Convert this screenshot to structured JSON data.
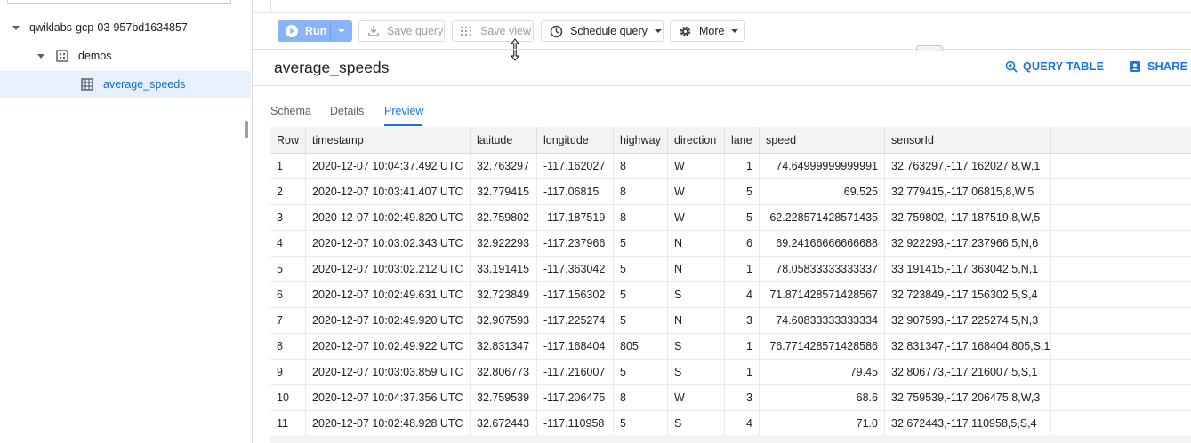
{
  "sidebar": {
    "project": "qwiklabs-gcp-03-957bd1634857",
    "dataset": "demos",
    "table": "average_speeds"
  },
  "toolbar": {
    "run": "Run",
    "save_query": "Save query",
    "save_view": "Save view",
    "schedule_query": "Schedule query",
    "more": "More"
  },
  "details": {
    "title": "average_speeds",
    "query_table": "QUERY TABLE",
    "share_table": "SHARE T"
  },
  "tabs": [
    "Schema",
    "Details",
    "Preview"
  ],
  "active_tab": "Preview",
  "colors": {
    "accent": "#1a73e8",
    "run_button": "#8ab4f8",
    "selected_row": "#e8f0fe"
  },
  "grid": {
    "columns": [
      "Row",
      "timestamp",
      "latitude",
      "longitude",
      "highway",
      "direction",
      "lane",
      "speed",
      "sensorId"
    ],
    "rows": [
      [
        "1",
        "2020-12-07 10:04:37.492 UTC",
        "32.763297",
        "-117.162027",
        "8",
        "W",
        "1",
        "74.64999999999991",
        "32.763297,-117.162027,8,W,1"
      ],
      [
        "2",
        "2020-12-07 10:03:41.407 UTC",
        "32.779415",
        "-117.06815",
        "8",
        "W",
        "5",
        "69.525",
        "32.779415,-117.06815,8,W,5"
      ],
      [
        "3",
        "2020-12-07 10:02:49.820 UTC",
        "32.759802",
        "-117.187519",
        "8",
        "W",
        "5",
        "62.228571428571435",
        "32.759802,-117.187519,8,W,5"
      ],
      [
        "4",
        "2020-12-07 10:03:02.343 UTC",
        "32.922293",
        "-117.237966",
        "5",
        "N",
        "6",
        "69.24166666666688",
        "32.922293,-117.237966,5,N,6"
      ],
      [
        "5",
        "2020-12-07 10:03:02.212 UTC",
        "33.191415",
        "-117.363042",
        "5",
        "N",
        "1",
        "78.05833333333337",
        "33.191415,-117.363042,5,N,1"
      ],
      [
        "6",
        "2020-12-07 10:02:49.631 UTC",
        "32.723849",
        "-117.156302",
        "5",
        "S",
        "4",
        "71.871428571428567",
        "32.723849,-117.156302,5,S,4"
      ],
      [
        "7",
        "2020-12-07 10:02:49.920 UTC",
        "32.907593",
        "-117.225274",
        "5",
        "N",
        "3",
        "74.60833333333334",
        "32.907593,-117.225274,5,N,3"
      ],
      [
        "8",
        "2020-12-07 10:02:49.922 UTC",
        "32.831347",
        "-117.168404",
        "805",
        "S",
        "1",
        "76.771428571428586",
        "32.831347,-117.168404,805,S,1"
      ],
      [
        "9",
        "2020-12-07 10:03:03.859 UTC",
        "32.806773",
        "-117.216007",
        "5",
        "S",
        "1",
        "79.45",
        "32.806773,-117.216007,5,S,1"
      ],
      [
        "10",
        "2020-12-07 10:04:37.356 UTC",
        "32.759539",
        "-117.206475",
        "8",
        "W",
        "3",
        "68.6",
        "32.759539,-117.206475,8,W,3"
      ],
      [
        "11",
        "2020-12-07 10:02:48.928 UTC",
        "32.672443",
        "-117.110958",
        "5",
        "S",
        "4",
        "71.0",
        "32.672443,-117.110958,5,S,4"
      ]
    ]
  }
}
